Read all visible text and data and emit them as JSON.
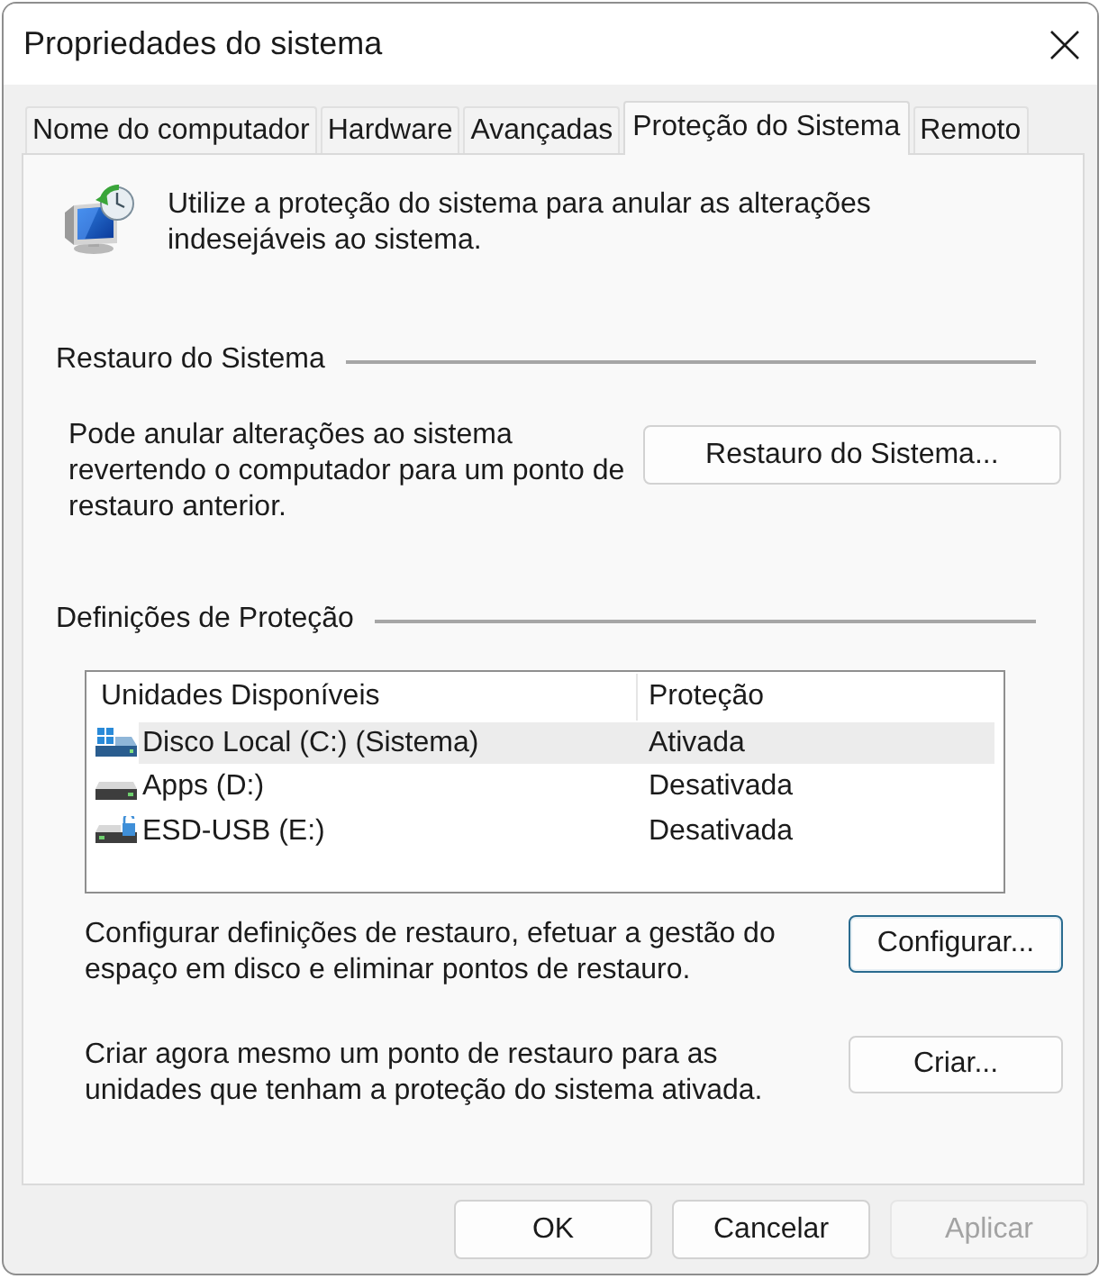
{
  "window": {
    "title": "Propriedades do sistema"
  },
  "tabs": [
    {
      "label": "Nome do computador",
      "selected": false
    },
    {
      "label": "Hardware",
      "selected": false
    },
    {
      "label": "Avançadas",
      "selected": false
    },
    {
      "label": "Proteção do Sistema",
      "selected": true
    },
    {
      "label": "Remoto",
      "selected": false
    }
  ],
  "intro": {
    "text": "Utilize a proteção do sistema para anular as alterações indesejáveis ao sistema."
  },
  "restore": {
    "title": "Restauro do Sistema",
    "description": "Pode anular alterações ao sistema revertendo o computador para um ponto de restauro anterior.",
    "button": {
      "label": "Restauro do Sistema...",
      "focused": false
    }
  },
  "protection": {
    "title": "Definições de Proteção",
    "table": {
      "columns": [
        "Unidades Disponíveis",
        "Proteção"
      ],
      "rows": [
        {
          "kind": "system",
          "drive": "Disco Local (C:) (Sistema)",
          "protection": "Ativada",
          "selected": true
        },
        {
          "kind": "drive",
          "drive": "Apps (D:)",
          "protection": "Desativada",
          "selected": false
        },
        {
          "kind": "usb",
          "drive": "ESD-USB (E:)",
          "protection": "Desativada",
          "selected": false
        }
      ]
    },
    "actions": [
      {
        "description": "Configurar definições de restauro, efetuar a gestão do espaço em disco e eliminar pontos de restauro.",
        "button": {
          "label": "Configurar...",
          "focused": true
        }
      },
      {
        "description": "Criar agora mesmo um ponto de restauro para as unidades que tenham a proteção do sistema ativada.",
        "button": {
          "label": "Criar...",
          "focused": false
        }
      }
    ]
  },
  "buttons": [
    {
      "label": "OK",
      "disabled": false
    },
    {
      "label": "Cancelar",
      "disabled": false
    },
    {
      "label": "Aplicar",
      "disabled": true
    }
  ]
}
